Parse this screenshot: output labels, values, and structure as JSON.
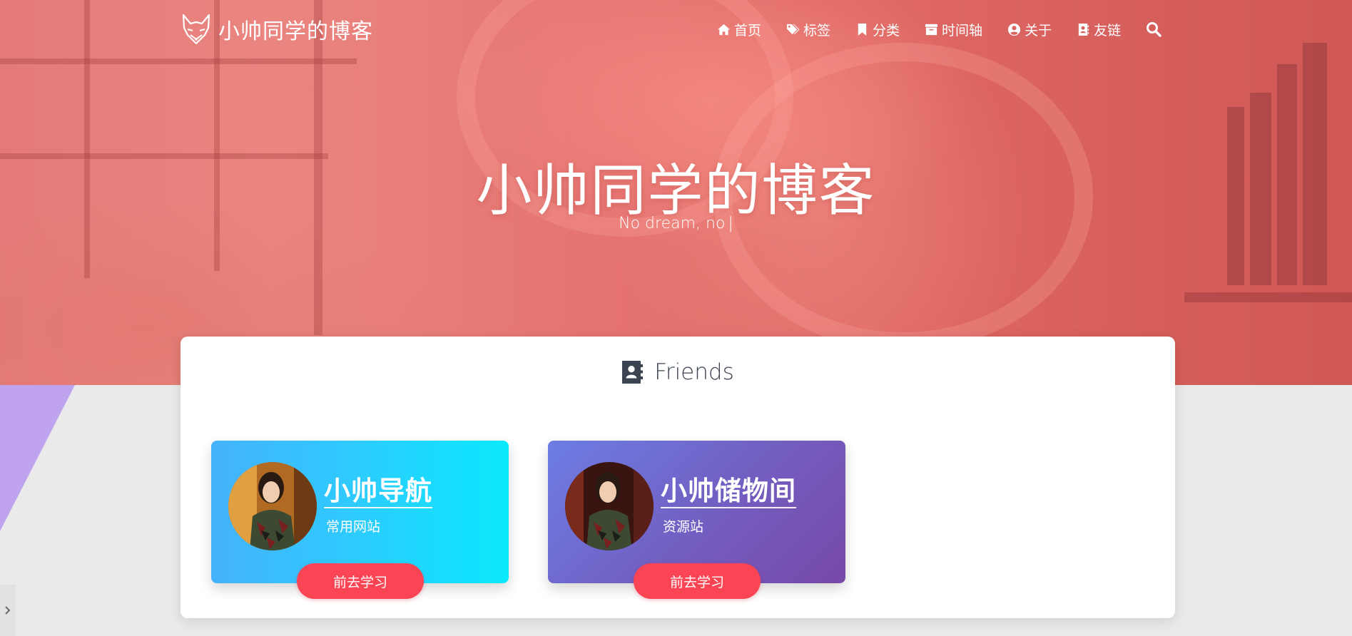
{
  "nav": {
    "brand": "小帅同学的博客",
    "logo_icon": "fox-icon",
    "items": [
      {
        "label": "首页",
        "icon": "home-icon"
      },
      {
        "label": "标签",
        "icon": "tags-icon"
      },
      {
        "label": "分类",
        "icon": "bookmark-icon"
      },
      {
        "label": "时间轴",
        "icon": "archive-icon"
      },
      {
        "label": "关于",
        "icon": "user-circle-icon"
      },
      {
        "label": "友链",
        "icon": "address-book-icon"
      }
    ],
    "search_icon": "search-icon"
  },
  "hero": {
    "title": "小帅同学的博客",
    "subtitle": "No dream, no",
    "cursor": "|"
  },
  "friends_section": {
    "title": "Friends",
    "icon": "address-book-icon",
    "cards": [
      {
        "name": "小帅导航",
        "desc": "常用网站",
        "button": "前去学习"
      },
      {
        "name": "小帅储物间",
        "desc": "资源站",
        "button": "前去学习"
      }
    ]
  },
  "colors": {
    "hero_tint": "#e27471",
    "card1_gradient": [
      "#45b2fb",
      "#0be9fd"
    ],
    "card2_gradient": [
      "#6c7de4",
      "#7749a8"
    ],
    "button": "#fb4454",
    "side_triangle": "#bfa3ef"
  }
}
